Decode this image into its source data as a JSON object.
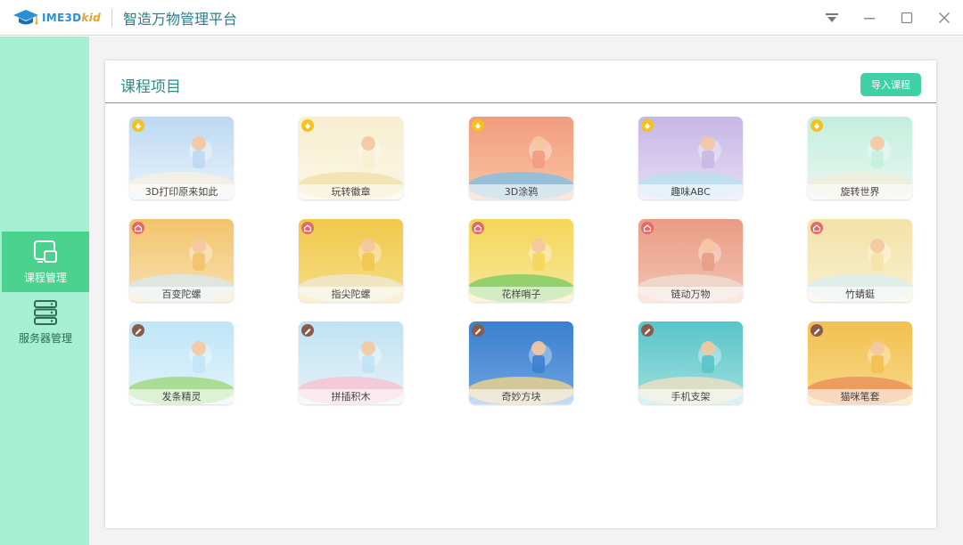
{
  "window": {
    "logo_text": "IME3D",
    "logo_kid": "kid",
    "title": "智造万物管理平台"
  },
  "sidebar": {
    "items": [
      {
        "label": "课程管理",
        "icon": "course-icon",
        "active": true
      },
      {
        "label": "服务器管理",
        "icon": "server-icon",
        "active": false
      }
    ]
  },
  "panel": {
    "title": "课程项目",
    "import_label": "导入课程"
  },
  "courses": [
    {
      "label": "3D打印原来如此",
      "badge": "yellow",
      "colors": [
        "#bcd9f2",
        "#e9f3fb",
        "#f7f0e2"
      ]
    },
    {
      "label": "玩转徽章",
      "badge": "yellow",
      "colors": [
        "#f7efcf",
        "#faf6e6",
        "#f1e1a8"
      ]
    },
    {
      "label": "3D涂鸦",
      "badge": "yellow",
      "colors": [
        "#f29c7e",
        "#f8c5a2",
        "#7fbfe6"
      ]
    },
    {
      "label": "趣味ABC",
      "badge": "yellow",
      "colors": [
        "#c7b7e6",
        "#e5dcf3",
        "#b7e0ef"
      ]
    },
    {
      "label": "旋转世界",
      "badge": "yellow",
      "colors": [
        "#c5eedf",
        "#e7f7f1",
        "#f1ecd9"
      ]
    },
    {
      "label": "百变陀螺",
      "badge": "red",
      "colors": [
        "#f3c36b",
        "#f7e1b2",
        "#d9e8f0"
      ]
    },
    {
      "label": "指尖陀螺",
      "badge": "red",
      "colors": [
        "#f1c84b",
        "#f6dd83",
        "#efe9d4"
      ]
    },
    {
      "label": "花样哨子",
      "badge": "red",
      "colors": [
        "#f4d659",
        "#f7e79a",
        "#7acb64"
      ]
    },
    {
      "label": "链动万物",
      "badge": "red",
      "colors": [
        "#e99c84",
        "#f3c3b3",
        "#eeddd2"
      ]
    },
    {
      "label": "竹蜻蜓",
      "badge": "red",
      "colors": [
        "#f4e2a6",
        "#f9f0d0",
        "#d9eef2"
      ]
    },
    {
      "label": "发条精灵",
      "badge": "brown",
      "colors": [
        "#bfe5f7",
        "#e3f3fb",
        "#9ed77a"
      ]
    },
    {
      "label": "拼插积木",
      "badge": "brown",
      "colors": [
        "#bfe2f3",
        "#e7f2f9",
        "#f6c1cf"
      ]
    },
    {
      "label": "奇妙方块",
      "badge": "brown",
      "colors": [
        "#3a7fcf",
        "#6ea4e0",
        "#f1d28a"
      ]
    },
    {
      "label": "手机支架",
      "badge": "brown",
      "colors": [
        "#58c4c9",
        "#9ee0df",
        "#f0dfc0"
      ]
    },
    {
      "label": "猫咪笔套",
      "badge": "brown",
      "colors": [
        "#f2c04f",
        "#f7d988",
        "#e6905a"
      ]
    }
  ]
}
